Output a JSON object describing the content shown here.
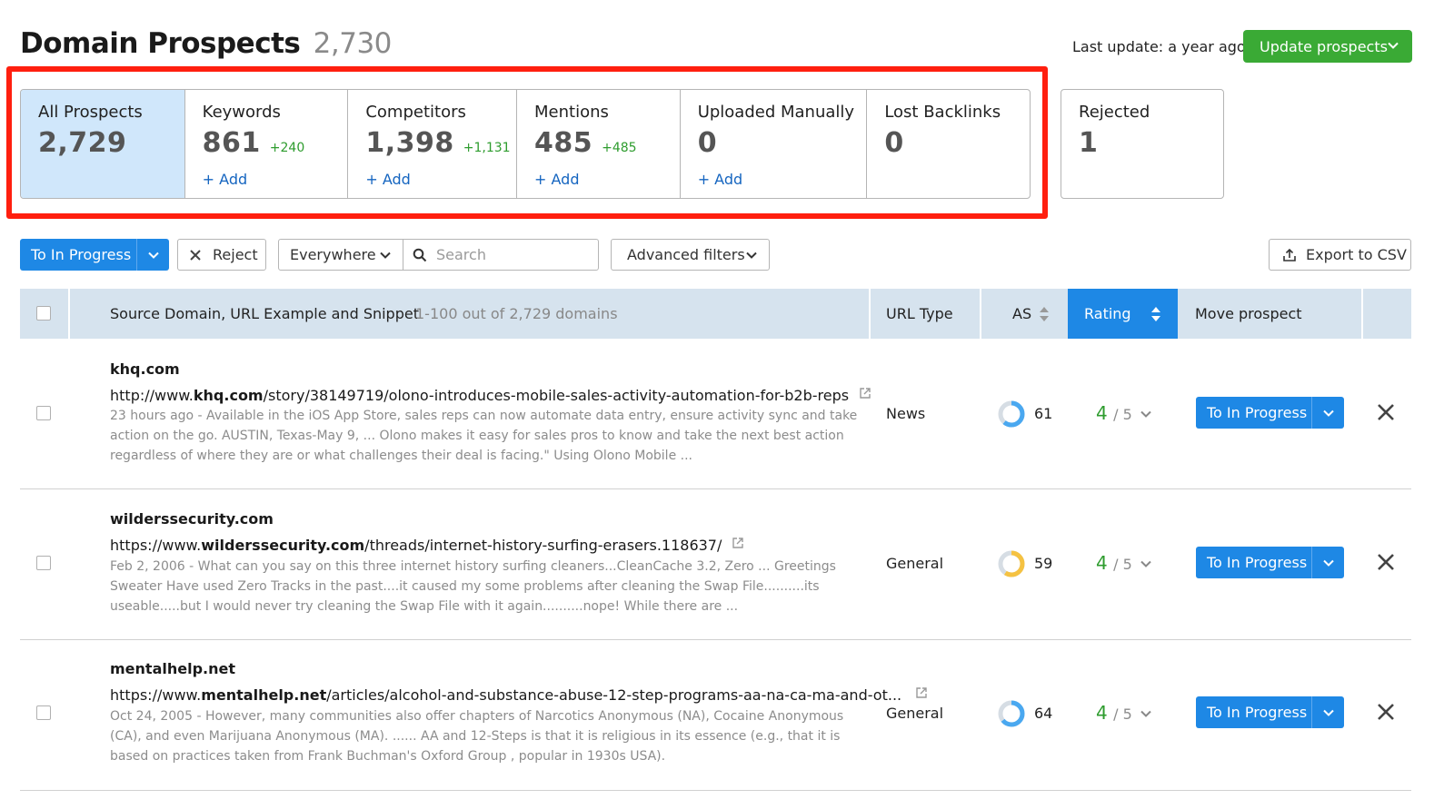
{
  "header": {
    "title": "Domain Prospects",
    "count": "2,730",
    "last_update": "Last update: a year ago",
    "update_button": "Update prospects"
  },
  "stats": [
    {
      "label": "All Prospects",
      "value": "2,729",
      "delta": "",
      "add": "",
      "active": true
    },
    {
      "label": "Keywords",
      "value": "861",
      "delta": "+240",
      "add": "+ Add"
    },
    {
      "label": "Competitors",
      "value": "1,398",
      "delta": "+1,131",
      "add": "+ Add"
    },
    {
      "label": "Mentions",
      "value": "485",
      "delta": "+485",
      "add": "+ Add"
    },
    {
      "label": "Uploaded Manually",
      "value": "0",
      "delta": "",
      "add": "+ Add"
    },
    {
      "label": "Lost Backlinks",
      "value": "0",
      "delta": "",
      "add": ""
    }
  ],
  "rejected": {
    "label": "Rejected",
    "value": "1"
  },
  "toolbar": {
    "to_in_progress": "To In Progress",
    "reject": "Reject",
    "scope": "Everywhere",
    "search_placeholder": "Search",
    "advanced_filters": "Advanced filters",
    "export": "Export to CSV"
  },
  "table": {
    "col_source": "Source Domain, URL Example and Snippet",
    "range": "1-100 out of 2,729 domains",
    "col_url_type": "URL Type",
    "col_as": "AS",
    "col_rating": "Rating",
    "col_move": "Move prospect",
    "rows": [
      {
        "domain": "khq.com",
        "url_prefix": "http://www.",
        "url_domain": "khq.com",
        "url_path": "/story/38149719/olono-introduces-mobile-sales-activity-automation-for-b2b-reps",
        "snippet": "23 hours ago - Available in the iOS App Store, sales reps can now automate data entry, ensure activity sync and take action on the go. AUSTIN, Texas-May 9, ... Olono makes it easy for sales pros to know and take the next best action regardless of where they are or what challenges their deal is facing.\" Using Olono Mobile ...",
        "url_type": "News",
        "as": "61",
        "as_fraction": 0.61,
        "rating": "4",
        "rating_max": "/ 5",
        "action": "To In Progress"
      },
      {
        "domain": "wilderssecurity.com",
        "url_prefix": "https://www.",
        "url_domain": "wilderssecurity.com",
        "url_path": "/threads/internet-history-surfing-erasers.118637/",
        "snippet": "Feb 2, 2006 - What can you say on this three internet history surfing cleaners...CleanCache 3.2, Zero ... Greetings Sweater Have used Zero Tracks in the past....it caused my some problems after cleaning the Swap File..........its useable.....but I would never try cleaning the Swap File with it again..........nope! While there are ...",
        "url_type": "General",
        "as": "59",
        "as_fraction": 0.59,
        "rating": "4",
        "rating_max": "/ 5",
        "action": "To In Progress"
      },
      {
        "domain": "mentalhelp.net",
        "url_prefix": "https://www.",
        "url_domain": "mentalhelp.net",
        "url_path": "/articles/alcohol-and-substance-abuse-12-step-programs-aa-na-ca-ma-and-ot...",
        "snippet": "Oct 24, 2005 - However, many communities also offer chapters of Narcotics Anonymous (NA), Cocaine Anonymous (CA), and even Marijuana Anonymous (MA). ...... AA and 12-Steps is that it is religious in its essence (e.g., that it is based on practices taken from Frank Buchman's Oxford Group , popular in 1930s USA).",
        "url_type": "General",
        "as": "64",
        "as_fraction": 0.64,
        "rating": "4",
        "rating_max": "/ 5",
        "action": "To In Progress"
      }
    ]
  },
  "colors": {
    "primary": "#1e88e5",
    "success": "#3aaa35",
    "highlight": "#ff1f0f",
    "header_bg": "#d6e3ee",
    "active_tab": "#d0e7fb"
  }
}
